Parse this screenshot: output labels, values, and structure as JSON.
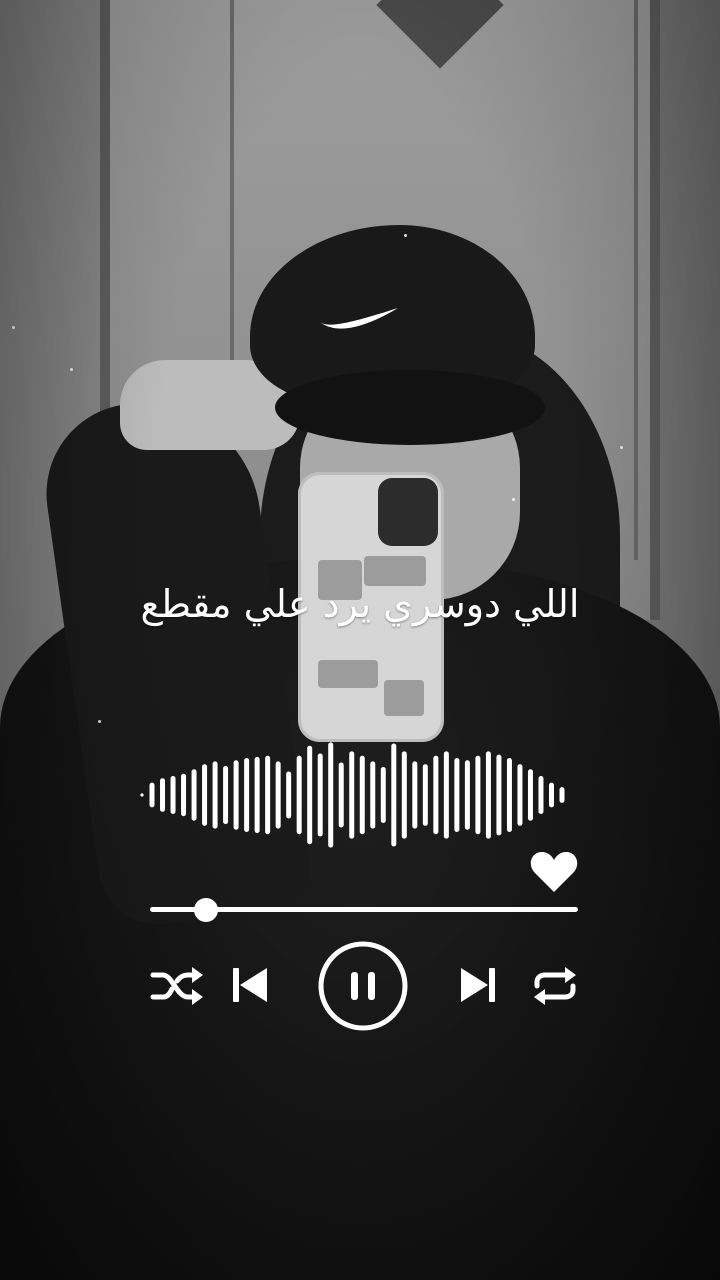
{
  "song": {
    "title": "اللي دوسري يرد علي مقطع"
  },
  "player": {
    "progress_fraction": 0.132,
    "liked": true,
    "is_playing": true,
    "waveform_heights": [
      0.22,
      0.3,
      0.34,
      0.38,
      0.46,
      0.55,
      0.6,
      0.52,
      0.62,
      0.66,
      0.68,
      0.7,
      0.6,
      0.42,
      0.7,
      0.88,
      0.74,
      0.94,
      0.58,
      0.78,
      0.7,
      0.6,
      0.5,
      0.92,
      0.78,
      0.6,
      0.55,
      0.7,
      0.78,
      0.66,
      0.62,
      0.7,
      0.78,
      0.72,
      0.66,
      0.55,
      0.46,
      0.34,
      0.22,
      0.14
    ]
  },
  "icons": {
    "shuffle": "shuffle-icon",
    "previous": "skip-previous-icon",
    "pause": "pause-icon",
    "next": "skip-next-icon",
    "repeat": "repeat-icon",
    "like": "heart-icon"
  },
  "colors": {
    "foreground": "#ffffff"
  }
}
